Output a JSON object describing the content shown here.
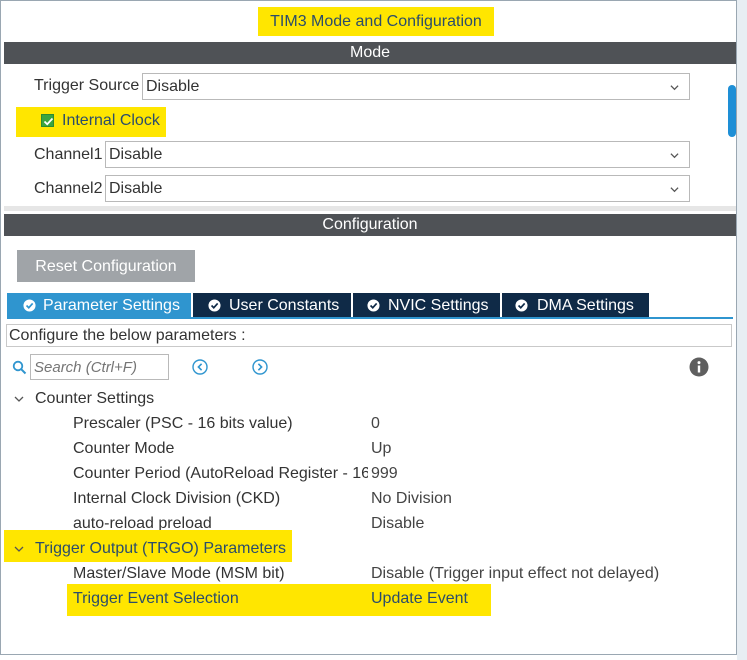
{
  "window_title": "TIM3 Mode and Configuration",
  "mode": {
    "header": "Mode",
    "trigger_source": {
      "label": "Trigger Source",
      "value": "Disable"
    },
    "internal_clock": {
      "label": "Internal Clock",
      "checked": true
    },
    "channel1": {
      "label": "Channel1",
      "value": "Disable"
    },
    "channel2": {
      "label": "Channel2",
      "value": "Disable"
    }
  },
  "configuration": {
    "header": "Configuration",
    "reset_button": "Reset Configuration",
    "tabs": [
      {
        "label": "Parameter Settings",
        "active": true
      },
      {
        "label": "User Constants",
        "active": false
      },
      {
        "label": "NVIC Settings",
        "active": false
      },
      {
        "label": "DMA Settings",
        "active": false
      }
    ],
    "description": "Configure the below parameters :",
    "search_placeholder": "Search (Ctrl+F)",
    "groups": [
      {
        "title": "Counter Settings",
        "params": [
          {
            "name": "Prescaler (PSC - 16 bits value)",
            "value": "0"
          },
          {
            "name": "Counter Mode",
            "value": "Up"
          },
          {
            "name": "Counter Period (AutoReload Register - 16...",
            "value": "999"
          },
          {
            "name": "Internal Clock Division (CKD)",
            "value": "No Division"
          },
          {
            "name": "auto-reload preload",
            "value": "Disable"
          }
        ]
      },
      {
        "title": "Trigger Output (TRGO) Parameters",
        "params": [
          {
            "name": "Master/Slave Mode (MSM bit)",
            "value": "Disable (Trigger input effect not delayed)"
          },
          {
            "name": "Trigger Event Selection",
            "value": "Update Event"
          }
        ]
      }
    ]
  },
  "colors": {
    "highlight": "#ffe600",
    "header_bar": "#4f5256",
    "tab_active": "#2f95cf",
    "tab_inactive": "#0f2a47",
    "check": "#3aa540"
  }
}
